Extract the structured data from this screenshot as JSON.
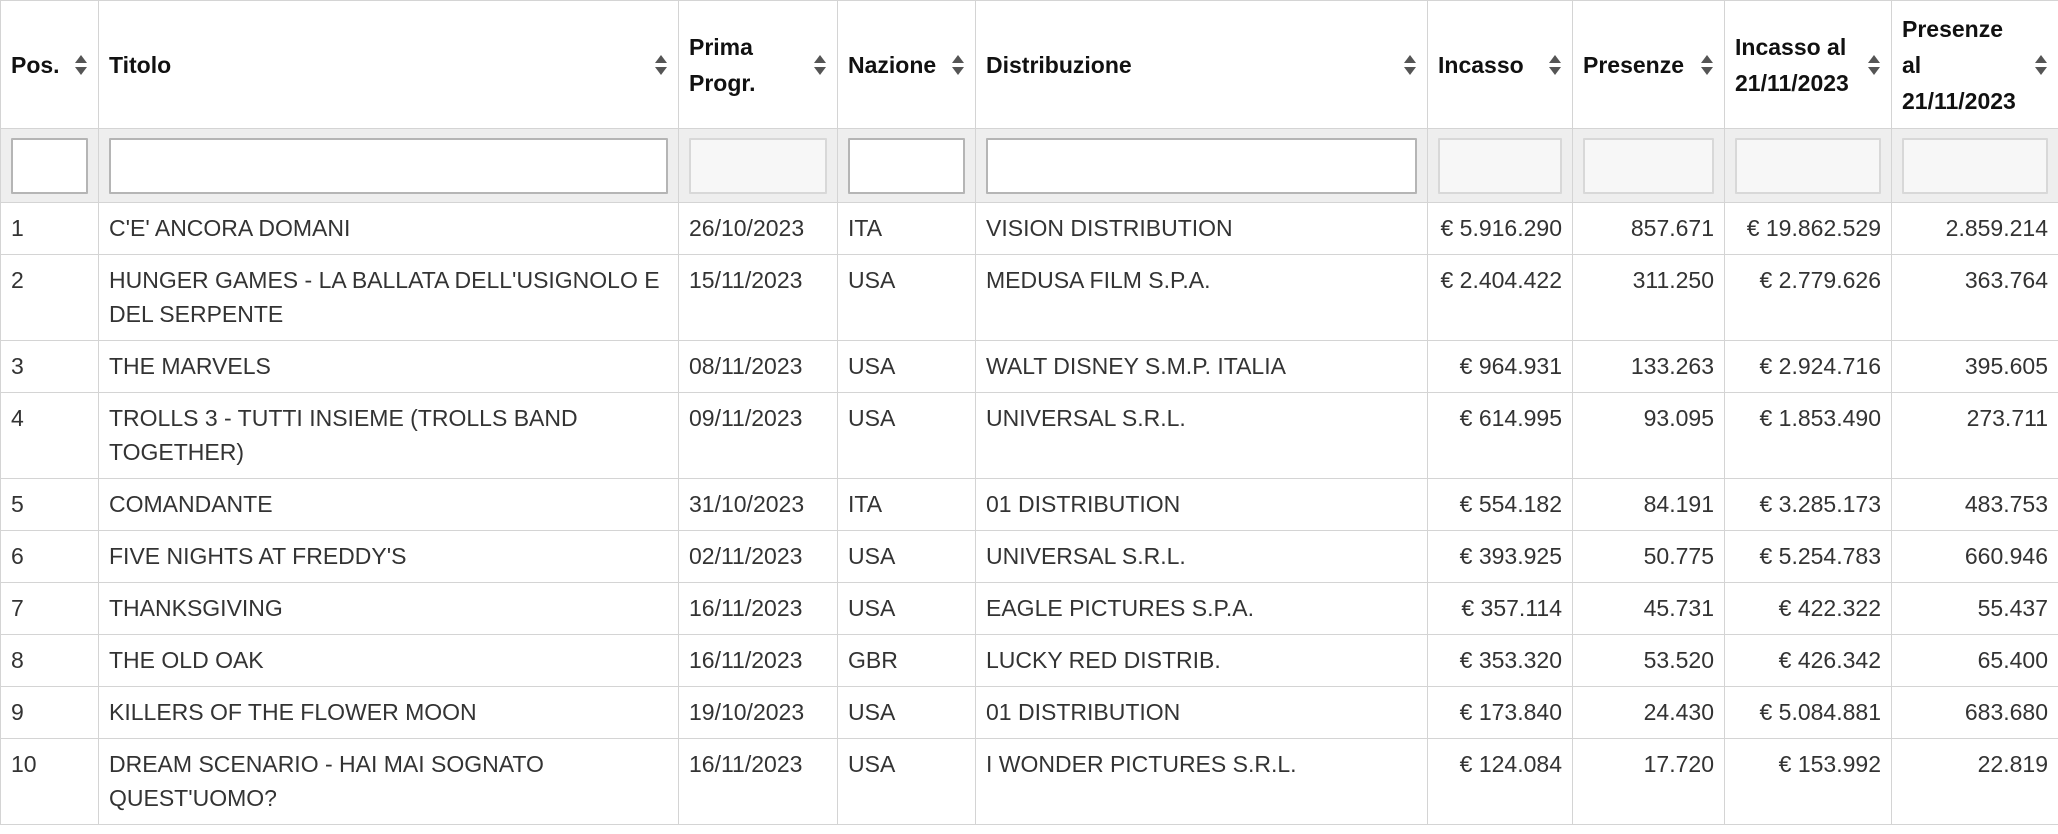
{
  "headers": {
    "pos": "Pos.",
    "titolo": "Titolo",
    "prima": "Prima Progr.",
    "nazione": "Nazione",
    "distribuzione": "Distribuzione",
    "incasso": "Incasso",
    "presenze": "Presenze",
    "incasso_al": "Incasso al 21/11/2023",
    "presenze_al": "Presenze al 21/11/2023"
  },
  "rows": [
    {
      "pos": "1",
      "titolo": "C'E' ANCORA DOMANI",
      "prima": "26/10/2023",
      "nazione": "ITA",
      "distribuzione": "VISION DISTRIBUTION",
      "incasso": "€ 5.916.290",
      "presenze": "857.671",
      "incasso_al": "€ 19.862.529",
      "presenze_al": "2.859.214"
    },
    {
      "pos": "2",
      "titolo": "HUNGER GAMES - LA BALLATA DELL'USIGNOLO E DEL SERPENTE",
      "prima": "15/11/2023",
      "nazione": "USA",
      "distribuzione": "MEDUSA FILM S.P.A.",
      "incasso": "€ 2.404.422",
      "presenze": "311.250",
      "incasso_al": "€ 2.779.626",
      "presenze_al": "363.764"
    },
    {
      "pos": "3",
      "titolo": "THE MARVELS",
      "prima": "08/11/2023",
      "nazione": "USA",
      "distribuzione": "WALT DISNEY S.M.P. ITALIA",
      "incasso": "€ 964.931",
      "presenze": "133.263",
      "incasso_al": "€ 2.924.716",
      "presenze_al": "395.605"
    },
    {
      "pos": "4",
      "titolo": "TROLLS 3 - TUTTI INSIEME (TROLLS BAND TOGETHER)",
      "prima": "09/11/2023",
      "nazione": "USA",
      "distribuzione": "UNIVERSAL S.R.L.",
      "incasso": "€ 614.995",
      "presenze": "93.095",
      "incasso_al": "€ 1.853.490",
      "presenze_al": "273.711"
    },
    {
      "pos": "5",
      "titolo": "COMANDANTE",
      "prima": "31/10/2023",
      "nazione": "ITA",
      "distribuzione": "01 DISTRIBUTION",
      "incasso": "€ 554.182",
      "presenze": "84.191",
      "incasso_al": "€ 3.285.173",
      "presenze_al": "483.753"
    },
    {
      "pos": "6",
      "titolo": "FIVE NIGHTS AT FREDDY'S",
      "prima": "02/11/2023",
      "nazione": "USA",
      "distribuzione": "UNIVERSAL S.R.L.",
      "incasso": "€ 393.925",
      "presenze": "50.775",
      "incasso_al": "€ 5.254.783",
      "presenze_al": "660.946"
    },
    {
      "pos": "7",
      "titolo": "THANKSGIVING",
      "prima": "16/11/2023",
      "nazione": "USA",
      "distribuzione": "EAGLE PICTURES S.P.A.",
      "incasso": "€ 357.114",
      "presenze": "45.731",
      "incasso_al": "€ 422.322",
      "presenze_al": "55.437"
    },
    {
      "pos": "8",
      "titolo": "THE OLD OAK",
      "prima": "16/11/2023",
      "nazione": "GBR",
      "distribuzione": "LUCKY RED DISTRIB.",
      "incasso": "€ 353.320",
      "presenze": "53.520",
      "incasso_al": "€ 426.342",
      "presenze_al": "65.400"
    },
    {
      "pos": "9",
      "titolo": "KILLERS OF THE FLOWER MOON",
      "prima": "19/10/2023",
      "nazione": "USA",
      "distribuzione": "01 DISTRIBUTION",
      "incasso": "€ 173.840",
      "presenze": "24.430",
      "incasso_al": "€ 5.084.881",
      "presenze_al": "683.680"
    },
    {
      "pos": "10",
      "titolo": "DREAM SCENARIO - HAI MAI SOGNATO QUEST'UOMO?",
      "prima": "16/11/2023",
      "nazione": "USA",
      "distribuzione": "I WONDER PICTURES S.R.L.",
      "incasso": "€ 124.084",
      "presenze": "17.720",
      "incasso_al": "€ 153.992",
      "presenze_al": "22.819"
    }
  ],
  "icons": {
    "sort": "sort-both-icon"
  },
  "colors": {
    "border": "#d4d4d4",
    "filter_bg": "#eeeeee",
    "text": "#333333"
  }
}
